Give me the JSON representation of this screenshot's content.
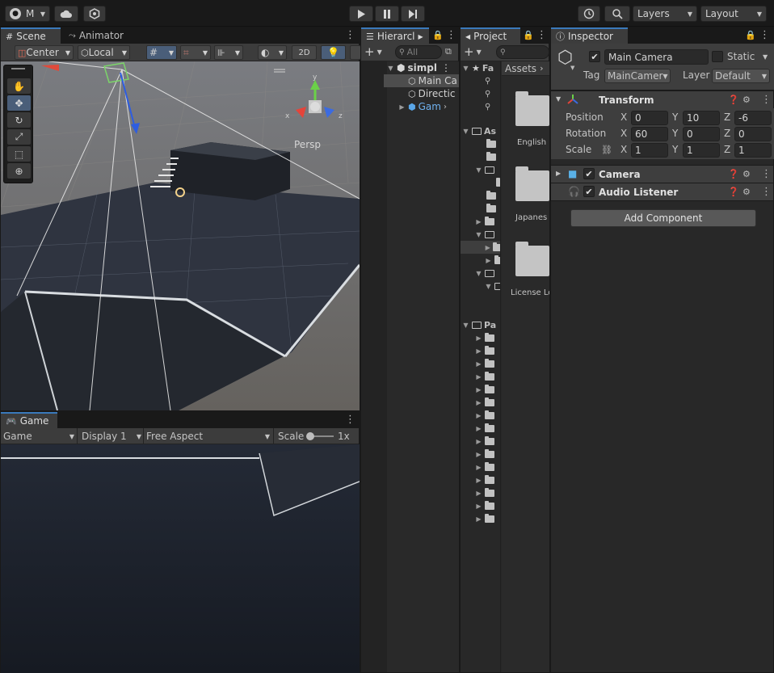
{
  "toolbar": {
    "account_label": "M",
    "layers_label": "Layers",
    "layout_label": "Layout"
  },
  "scene": {
    "tabs": [
      {
        "label": "Scene"
      },
      {
        "label": "Animator"
      }
    ],
    "pivot_label": "Center",
    "space_label": "Local",
    "mode_2d_label": "2D",
    "persp_label": "Persp",
    "gizmo_axes": {
      "x": "x",
      "y": "y",
      "z": "z"
    }
  },
  "game": {
    "tab_label": "Game",
    "view_select": "Game",
    "display_select": "Display 1",
    "aspect_select": "Free Aspect",
    "scale_label": "Scale",
    "scale_value": "1x",
    "scale_fraction": 0.0
  },
  "hierarchy": {
    "tab_label": "Hierarcl",
    "search_placeholder": "All",
    "scene_name": "simpl",
    "items": [
      {
        "label": "Main Ca"
      },
      {
        "label": "Directic"
      },
      {
        "label": "Gam"
      }
    ]
  },
  "project": {
    "tab_label": "Project",
    "favorites_label": "Fa",
    "assets_label": "As",
    "packages_label": "Pa",
    "breadcrumb": "Assets",
    "folders": [
      {
        "label": "English"
      },
      {
        "label": "Japanes"
      },
      {
        "label": "License Lo"
      }
    ]
  },
  "inspector": {
    "tab_label": "Inspector",
    "object_name": "Main Camera",
    "static_label": "Static",
    "tag_label": "Tag",
    "tag_value": "MainCamer",
    "layer_label": "Layer",
    "layer_value": "Default",
    "transform": {
      "title": "Transform",
      "position_label": "Position",
      "rotation_label": "Rotation",
      "scale_label": "Scale",
      "axis_x": "X",
      "axis_y": "Y",
      "axis_z": "Z",
      "position": {
        "x": "0",
        "y": "10",
        "z": "-6"
      },
      "rotation": {
        "x": "60",
        "y": "0",
        "z": "0"
      },
      "scale": {
        "x": "1",
        "y": "1",
        "z": "1"
      }
    },
    "components": [
      {
        "title": "Camera"
      },
      {
        "title": "Audio Listener"
      }
    ],
    "add_component_label": "Add Component"
  }
}
